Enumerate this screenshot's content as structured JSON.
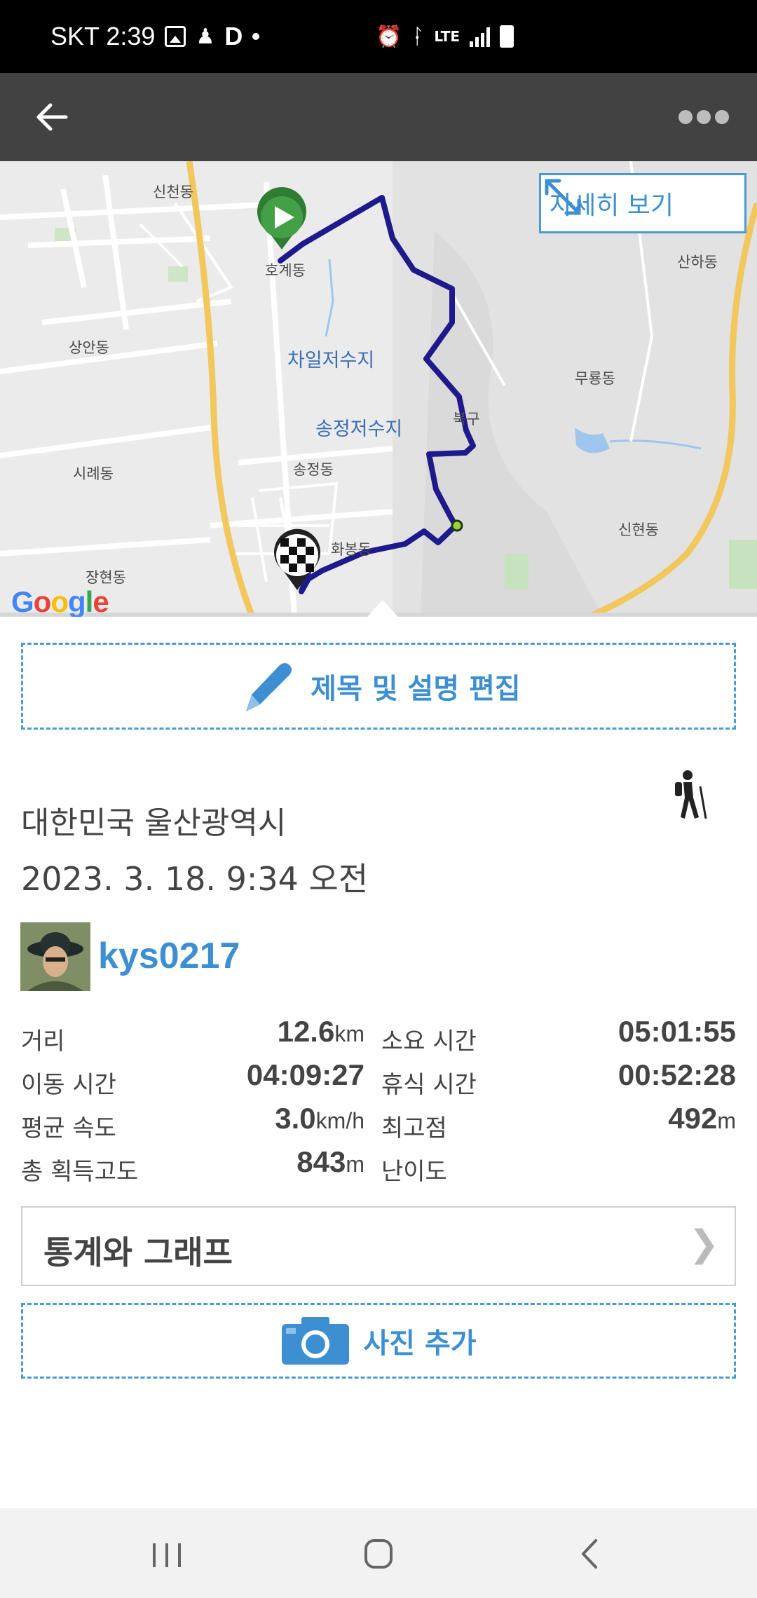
{
  "status_bar": {
    "carrier_time": "SKT 2:39",
    "network": "LTE",
    "icons": [
      "image-icon",
      "hiker-notification-icon",
      "d-app-icon",
      "dot-icon",
      "alarm-icon",
      "bluetooth-icon",
      "lte-icon",
      "signal-icon",
      "battery-icon"
    ]
  },
  "app_bar": {
    "back_icon": "arrow-left-icon",
    "more_icon": "more-dots-icon"
  },
  "map": {
    "detail_button": "자세히 보기",
    "attribution": "Google",
    "labels": {
      "sincheon": "신천동",
      "hogye": "호계동",
      "sanha": "산하동",
      "sangan": "상안동",
      "chail": "차일저수지",
      "muryong": "무룡동",
      "songjeong_res": "송정저수지",
      "bukgu": "북구",
      "sirye": "시례동",
      "songjeong": "송정동",
      "hwabong": "화봉동",
      "sinhyeon": "신현동",
      "janghyeon": "장현동"
    },
    "route_color": "#1f1a8c"
  },
  "edit": {
    "label": "제목 및 설명 편집"
  },
  "activity": {
    "location": "대한민국 울산광역시",
    "datetime": "2023. 3. 18. 9:34 오전",
    "type_icon": "hiking-icon"
  },
  "user": {
    "name": "kys0217"
  },
  "stats": {
    "distance_label": "거리",
    "distance_value": "12.6",
    "distance_unit": "km",
    "total_time_label": "소요 시간",
    "total_time_value": "05:01:55",
    "moving_time_label": "이동 시간",
    "moving_time_value": "04:09:27",
    "rest_time_label": "휴식 시간",
    "rest_time_value": "00:52:28",
    "avg_speed_label": "평균 속도",
    "avg_speed_value": "3.0",
    "avg_speed_unit": "km/h",
    "max_alt_label": "최고점",
    "max_alt_value": "492",
    "max_alt_unit": "m",
    "total_gain_label": "총 획득고도",
    "total_gain_value": "843",
    "total_gain_unit": "m",
    "difficulty_label": "난이도"
  },
  "stats_graph": {
    "label": "통계와 그래프",
    "chevron": "❯"
  },
  "photo": {
    "label": "사진 추가"
  },
  "colors": {
    "accent": "#3d8fd1",
    "app_bar": "#424242"
  }
}
